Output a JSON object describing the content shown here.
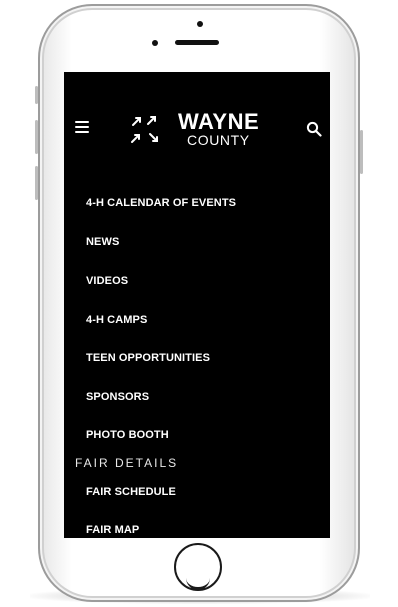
{
  "header": {
    "menu_icon": "hamburger-icon",
    "logo_mark_icon": "four-arrows-mark-icon",
    "logo_line1": "WAYNE",
    "logo_line2": "COUNTY",
    "search_icon": "search-icon"
  },
  "nav": {
    "items": [
      {
        "label": "4-H CALENDAR OF EVENTS"
      },
      {
        "label": "NEWS"
      },
      {
        "label": "VIDEOS"
      },
      {
        "label": "4-H CAMPS"
      },
      {
        "label": "TEEN OPPORTUNITIES"
      },
      {
        "label": "SPONSORS"
      },
      {
        "label": "PHOTO BOOTH"
      }
    ],
    "section_label": "FAIR DETAILS",
    "section_items": [
      {
        "label": "FAIR SCHEDULE"
      },
      {
        "label": "FAIR MAP"
      }
    ]
  },
  "colors": {
    "screen_bg": "#000000",
    "text": "#ffffff",
    "device_frame": "#ffffff"
  }
}
